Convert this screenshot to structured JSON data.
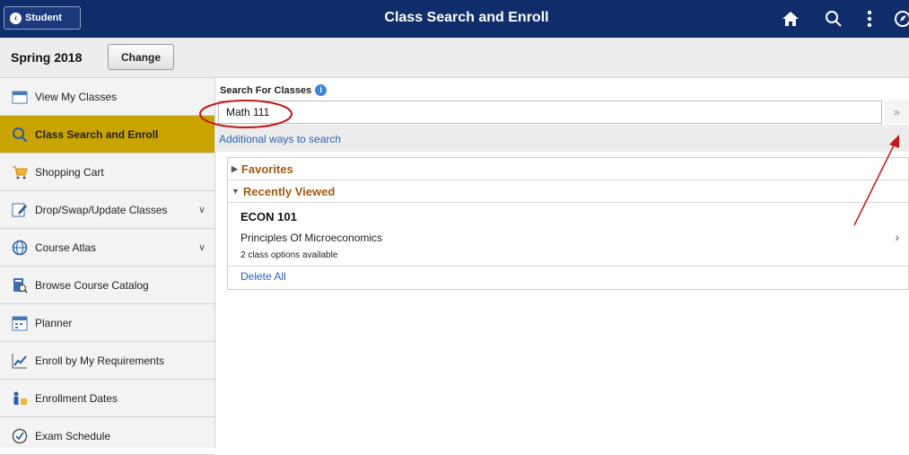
{
  "header": {
    "back_label": "Student",
    "title": "Class Search and Enroll",
    "icons": [
      "home-icon",
      "search-icon",
      "kebab-menu-icon",
      "navbar-icon"
    ]
  },
  "term": {
    "label": "Spring 2018",
    "change_label": "Change"
  },
  "sidebar": {
    "items": [
      {
        "label": "View My Classes",
        "icon": "calendar-icon",
        "active": false
      },
      {
        "label": "Class Search and Enroll",
        "icon": "magnifier-icon",
        "active": true
      },
      {
        "label": "Shopping Cart",
        "icon": "cart-icon",
        "active": false
      },
      {
        "label": "Drop/Swap/Update Classes",
        "icon": "edit-icon",
        "active": false,
        "expandable": true
      },
      {
        "label": "Course Atlas",
        "icon": "globe-icon",
        "active": false,
        "expandable": true
      },
      {
        "label": "Browse Course Catalog",
        "icon": "catalog-icon",
        "active": false
      },
      {
        "label": "Planner",
        "icon": "planner-icon",
        "active": false
      },
      {
        "label": "Enroll by My Requirements",
        "icon": "chart-icon",
        "active": false
      },
      {
        "label": "Enrollment Dates",
        "icon": "people-icon",
        "active": false
      },
      {
        "label": "Exam Schedule",
        "icon": "clock-icon",
        "active": false
      }
    ]
  },
  "search": {
    "label": "Search For Classes",
    "value": "Math 111",
    "go_symbol": "»",
    "additional_link": "Additional ways to search"
  },
  "favorites": {
    "label": "Favorites",
    "expanded": false
  },
  "recently_viewed": {
    "label": "Recently Viewed",
    "expanded": true,
    "courses": [
      {
        "code": "ECON 101",
        "name": "Principles Of Microeconomics",
        "options": "2 class options available"
      }
    ],
    "delete_all_label": "Delete All"
  },
  "colors": {
    "header_bg": "#102d6b",
    "active_item": "#c9a400",
    "link": "#2a63b8",
    "section_head": "#a25a12",
    "annotation": "#c41a1a"
  }
}
